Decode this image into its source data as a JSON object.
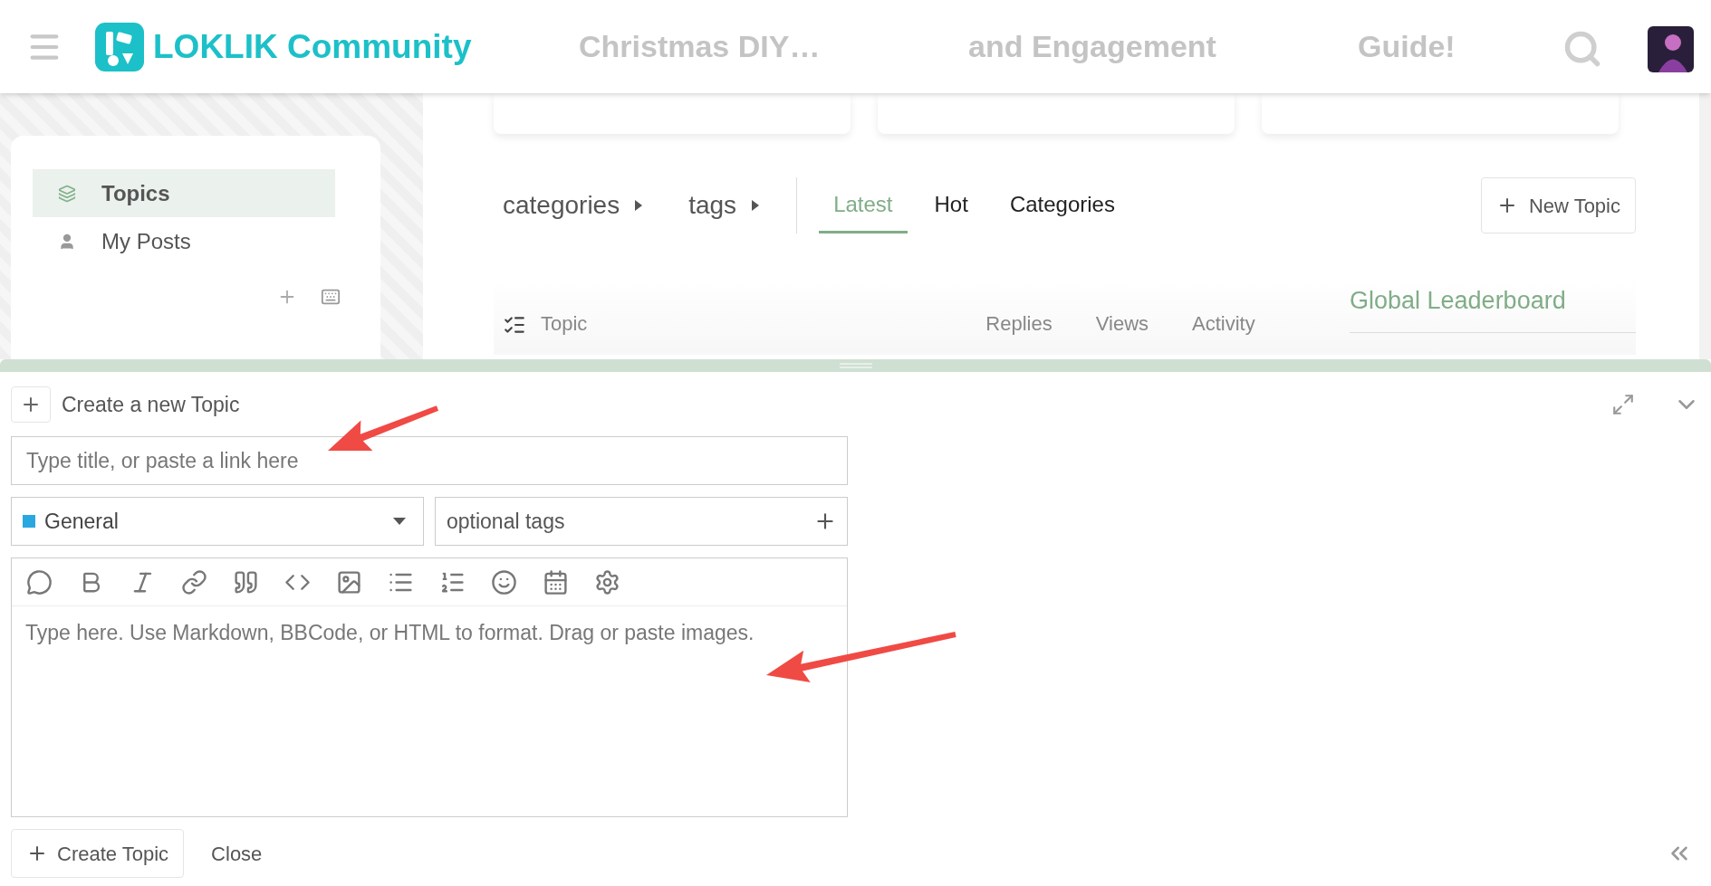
{
  "header": {
    "brand": "LOKLIK Community",
    "faded_cards": [
      "Christmas DIY…",
      "and Engagement",
      "Guide!"
    ]
  },
  "sidebar": {
    "items": [
      {
        "label": "Topics",
        "selected": true
      },
      {
        "label": "My Posts",
        "selected": false
      }
    ]
  },
  "nav": {
    "breadcrumbs": [
      "categories",
      "tags"
    ],
    "tabs": [
      {
        "label": "Latest",
        "selected": true
      },
      {
        "label": "Hot",
        "selected": false
      },
      {
        "label": "Categories",
        "selected": false
      }
    ],
    "new_topic_button": "New Topic"
  },
  "topic_list": {
    "columns": [
      "Topic",
      "Replies",
      "Views",
      "Activity"
    ]
  },
  "leaderboard": {
    "title": "Global Leaderboard"
  },
  "composer": {
    "title": "Create a new Topic",
    "title_field": {
      "placeholder": "Type title, or paste a link here"
    },
    "category": {
      "value": "General",
      "color": "#29a8e0"
    },
    "tags_field": {
      "placeholder": "optional tags"
    },
    "editor": {
      "placeholder": "Type here. Use Markdown, BBCode, or HTML to format. Drag or paste images."
    },
    "submit_button": "Create Topic",
    "close_button": "Close"
  }
}
